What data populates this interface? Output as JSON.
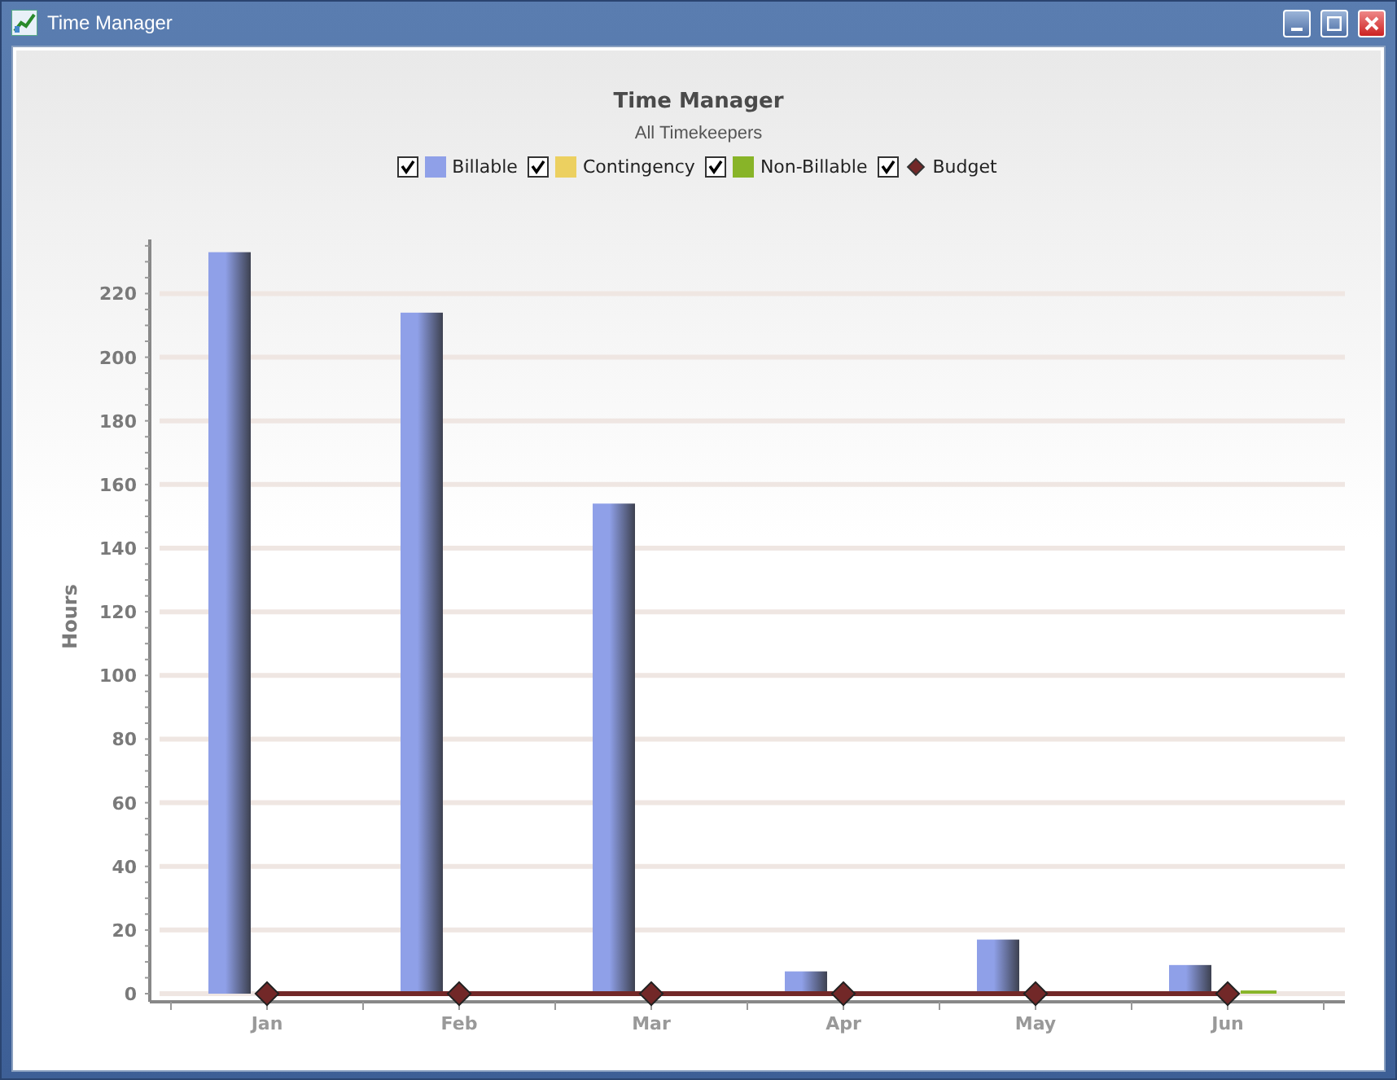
{
  "window": {
    "title": "Time Manager"
  },
  "chart": {
    "title": "Time Manager",
    "subtitle": "All Timekeepers",
    "legend": [
      {
        "checked": true,
        "kind": "bar"
      },
      {
        "checked": true,
        "kind": "bar"
      },
      {
        "checked": true,
        "kind": "bar"
      },
      {
        "checked": true,
        "kind": "line"
      }
    ],
    "chart_data": {
      "type": "bar",
      "ylabel": "Hours",
      "categories": [
        "Jan",
        "Feb",
        "Mar",
        "Apr",
        "May",
        "Jun"
      ],
      "series": [
        {
          "name": "Billable",
          "color": "#8fa0e8",
          "values": [
            233,
            214,
            154,
            7,
            17,
            9
          ]
        },
        {
          "name": "Contingency",
          "color": "#ecd060",
          "values": [
            0,
            0,
            0,
            0,
            0,
            0
          ]
        },
        {
          "name": "Non-Billable",
          "color": "#88b428",
          "values": [
            0,
            null,
            0,
            0,
            0,
            1
          ]
        },
        {
          "name": "Budget",
          "color": "#722828",
          "values": [
            0,
            0,
            0,
            0,
            0,
            0
          ]
        }
      ],
      "ylim": [
        0,
        237
      ],
      "yticks": [
        0,
        20,
        40,
        60,
        80,
        100,
        120,
        140,
        160,
        180,
        200,
        220
      ],
      "grid": true
    }
  }
}
